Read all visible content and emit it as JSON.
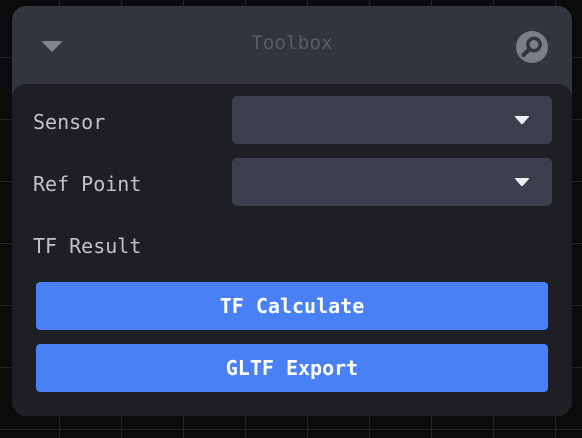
{
  "panel": {
    "title": "Toolbox",
    "header_icons": {
      "collapse": "chevron-down-icon",
      "search": "search-icon"
    }
  },
  "fields": [
    {
      "label": "Sensor",
      "value": "",
      "caret_icon": "caret-down-icon"
    },
    {
      "label": "Ref Point",
      "value": "",
      "caret_icon": "caret-down-icon"
    }
  ],
  "result": {
    "label": "TF Result"
  },
  "buttons": {
    "calculate": "TF Calculate",
    "export": "GLTF Export"
  },
  "colors": {
    "panel_header": "#33353d",
    "panel_body": "#1d1f24",
    "select_bg": "#3c3f4b",
    "button_bg": "#4a80f5",
    "label_text": "#c1c3c8",
    "title_text": "#595c66"
  }
}
